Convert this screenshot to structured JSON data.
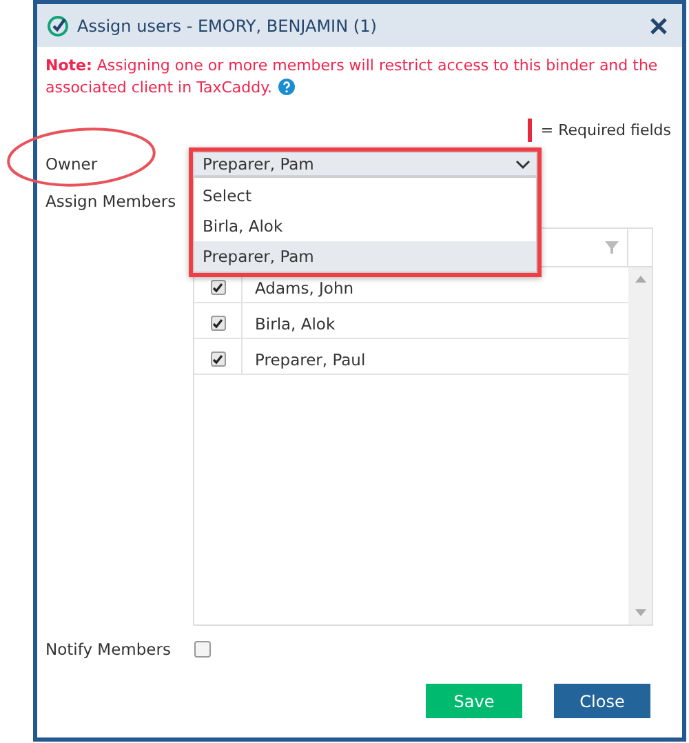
{
  "dialog": {
    "title": "Assign users - EMORY, BENJAMIN (1)"
  },
  "note": {
    "label": "Note:",
    "text": "Assigning one or more members will restrict access to this binder and the associated client in TaxCaddy."
  },
  "required_legend": "= Required fields",
  "owner": {
    "label": "Owner",
    "value": "Preparer, Pam",
    "expanded": true,
    "options": [
      {
        "label": "Select",
        "selected": false
      },
      {
        "label": "Birla, Alok",
        "selected": false
      },
      {
        "label": "Preparer, Pam",
        "selected": true
      }
    ]
  },
  "assign_members": {
    "label": "Assign Members",
    "rows": [
      {
        "name": "Adams, John",
        "checked": true
      },
      {
        "name": "Birla, Alok",
        "checked": true
      },
      {
        "name": "Preparer, Paul",
        "checked": true
      }
    ]
  },
  "notify_members": {
    "label": "Notify Members",
    "checked": false
  },
  "buttons": [
    {
      "label": "Save",
      "kind": "primary"
    },
    {
      "label": "Close",
      "kind": "secondary"
    }
  ]
}
